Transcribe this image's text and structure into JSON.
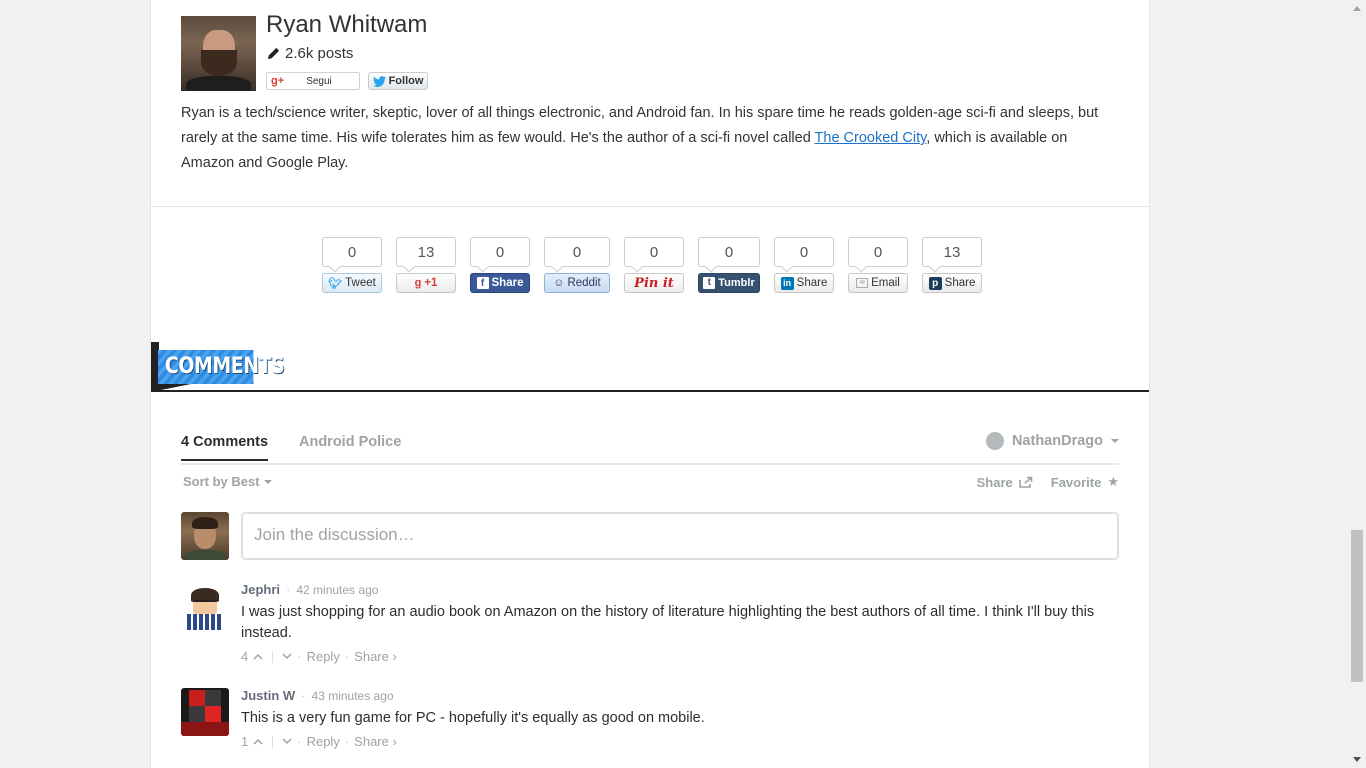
{
  "author": {
    "name": "Ryan Whitwam",
    "posts": "2.6k posts",
    "gplus_label": "Segui",
    "twitter_label": "Follow",
    "bio_part1": "Ryan is a tech/science writer, skeptic, lover of all things electronic, and Android fan. In his spare time he reads golden-age sci-fi and sleeps, but rarely at the same time. His wife tolerates him as few would. He's the author of a sci-fi novel called ",
    "bio_link": "The Crooked City",
    "bio_part2": ", which is available on Amazon and Google Play."
  },
  "share": [
    {
      "count": "0",
      "label": "Tweet",
      "icon": "twitter-icon"
    },
    {
      "count": "13",
      "label": "+1",
      "icon": "google-plus-icon"
    },
    {
      "count": "0",
      "label": "Share",
      "icon": "facebook-icon"
    },
    {
      "count": "0",
      "label": "Reddit",
      "icon": "reddit-icon"
    },
    {
      "count": "0",
      "label": "Pin it",
      "icon": "pinterest-icon"
    },
    {
      "count": "0",
      "label": "Tumblr",
      "icon": "tumblr-icon"
    },
    {
      "count": "0",
      "label": "Share",
      "icon": "linkedin-icon"
    },
    {
      "count": "0",
      "label": "Email",
      "icon": "email-icon"
    },
    {
      "count": "13",
      "label": "Share",
      "icon": "pocket-icon"
    }
  ],
  "comments_section": {
    "banner": "COMMENTS",
    "tab_count": "4 Comments",
    "tab_site": "Android Police",
    "user": "NathanDrago",
    "sort": "Sort by Best",
    "share": "Share",
    "favorite": "Favorite",
    "placeholder": "Join the discussion…"
  },
  "comments": [
    {
      "author": "Jephri",
      "time": "42 minutes ago",
      "text": "I was just shopping for an audio book on Amazon on the history of literature highlighting the best authors of all time. I think I'll buy this instead.",
      "votes": "4",
      "reply": "Reply",
      "share": "Share ›"
    },
    {
      "author": "Justin W",
      "time": "43 minutes ago",
      "text": "This is a very fun game for PC - hopefully it's equally as good on mobile.",
      "votes": "1",
      "reply": "Reply",
      "share": "Share ›"
    }
  ],
  "colors": {
    "link": "#1a73c9",
    "accent": "#4aa3f0",
    "facebook": "#3b5998",
    "tumblr": "#34526f"
  }
}
